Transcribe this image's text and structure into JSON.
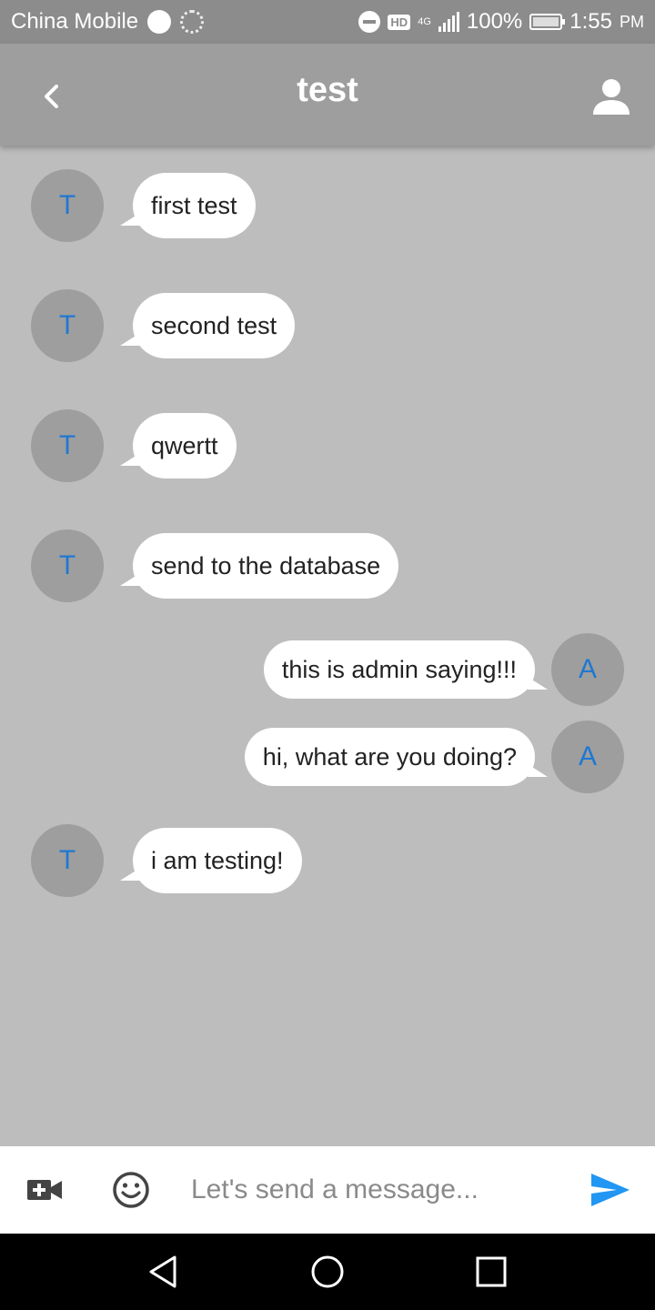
{
  "status_bar": {
    "carrier": "China Mobile",
    "hd_badge": "HD",
    "network": "4G",
    "battery": "100%",
    "time": "1:55",
    "ampm": "PM"
  },
  "header": {
    "title": "test",
    "back_icon": "chevron-left-icon",
    "profile_icon": "person-icon"
  },
  "messages": [
    {
      "sender": "other",
      "avatar": "T",
      "text": "first test"
    },
    {
      "sender": "other",
      "avatar": "T",
      "text": "second test"
    },
    {
      "sender": "other",
      "avatar": "T",
      "text": "qwertt"
    },
    {
      "sender": "other",
      "avatar": "T",
      "text": "send to the database"
    },
    {
      "sender": "me",
      "avatar": "A",
      "text": "this is admin saying!!!"
    },
    {
      "sender": "me",
      "avatar": "A",
      "text": "hi, what are you doing?"
    },
    {
      "sender": "other",
      "avatar": "T",
      "text": "i am testing!"
    }
  ],
  "input_bar": {
    "placeholder": "Let's send a message...",
    "value": "",
    "video_icon": "video-add-icon",
    "emoji_icon": "emoji-icon",
    "send_icon": "send-icon"
  },
  "colors": {
    "chat_background": "#bdbdbd",
    "app_bar": "#9e9e9e",
    "avatar_bg": "#9e9e9e",
    "avatar_text": "#1f78d1",
    "send_accent": "#2196f3"
  }
}
